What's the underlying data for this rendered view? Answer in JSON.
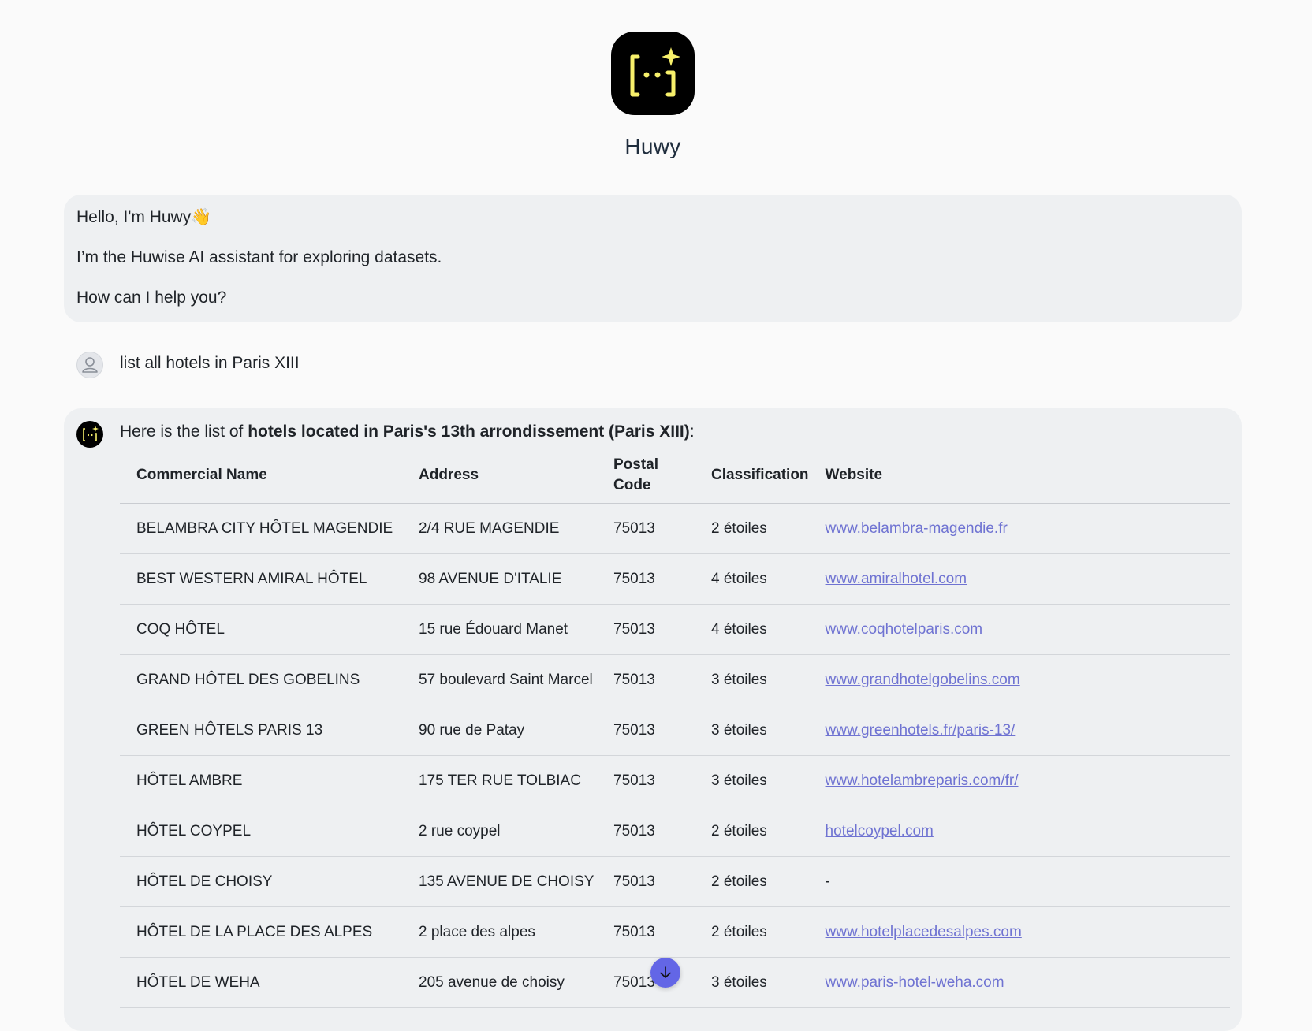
{
  "app": {
    "name": "Huwy",
    "accent_color": "#f7f06b",
    "link_color": "#6f73d2",
    "scroll_button_color": "#6366e6"
  },
  "welcome": {
    "line1": "Hello, I'm Huwy👋",
    "line2": "I’m the Huwise AI assistant for exploring datasets.",
    "line3": "How can I help you?"
  },
  "user_message": {
    "avatar_icon": "user-icon",
    "text": "list all hotels in Paris XIII"
  },
  "answer": {
    "intro_prefix": "Here is the list of ",
    "intro_bold": "hotels located in Paris's 13th arrondissement (Paris XIII)",
    "intro_suffix": ":",
    "table": {
      "headers": {
        "name": "Commercial Name",
        "address": "Address",
        "postal_code": "Postal Code",
        "classification": "Classification",
        "website": "Website"
      },
      "rows": [
        {
          "name": "BELAMBRA CITY HÔTEL MAGENDIE",
          "address": "2/4 RUE MAGENDIE",
          "postal_code": "75013",
          "classification": "2 étoiles",
          "website": "www.belambra-magendie.fr"
        },
        {
          "name": "BEST WESTERN AMIRAL HÔTEL",
          "address": "98 AVENUE D'ITALIE",
          "postal_code": "75013",
          "classification": "4 étoiles",
          "website": "www.amiralhotel.com"
        },
        {
          "name": "COQ HÔTEL",
          "address": "15 rue Édouard Manet",
          "postal_code": "75013",
          "classification": "4 étoiles",
          "website": "www.coqhotelparis.com"
        },
        {
          "name": "GRAND HÔTEL DES GOBELINS",
          "address": "57 boulevard Saint Marcel",
          "postal_code": "75013",
          "classification": "3 étoiles",
          "website": "www.grandhotelgobelins.com"
        },
        {
          "name": "GREEN HÔTELS PARIS 13",
          "address": "90 rue de Patay",
          "postal_code": "75013",
          "classification": "3 étoiles",
          "website": "www.greenhotels.fr/paris-13/"
        },
        {
          "name": "HÔTEL AMBRE",
          "address": "175 TER RUE TOLBIAC",
          "postal_code": "75013",
          "classification": "3 étoiles",
          "website": "www.hotelambreparis.com/fr/"
        },
        {
          "name": "HÔTEL COYPEL",
          "address": "2 rue coypel",
          "postal_code": "75013",
          "classification": "2 étoiles",
          "website": "hotelcoypel.com"
        },
        {
          "name": "HÔTEL DE CHOISY",
          "address": "135 AVENUE DE CHOISY",
          "postal_code": "75013",
          "classification": "2 étoiles",
          "website": "-"
        },
        {
          "name": "HÔTEL DE LA PLACE DES ALPES",
          "address": "2 place des alpes",
          "postal_code": "75013",
          "classification": "2 étoiles",
          "website": "www.hotelplacedesalpes.com"
        },
        {
          "name": "HÔTEL DE WEHA",
          "address": "205 avenue de choisy",
          "postal_code": "75013",
          "classification": "3 étoiles",
          "website": "www.paris-hotel-weha.com"
        }
      ]
    }
  },
  "scroll_button": {
    "icon": "arrow-down-icon"
  }
}
